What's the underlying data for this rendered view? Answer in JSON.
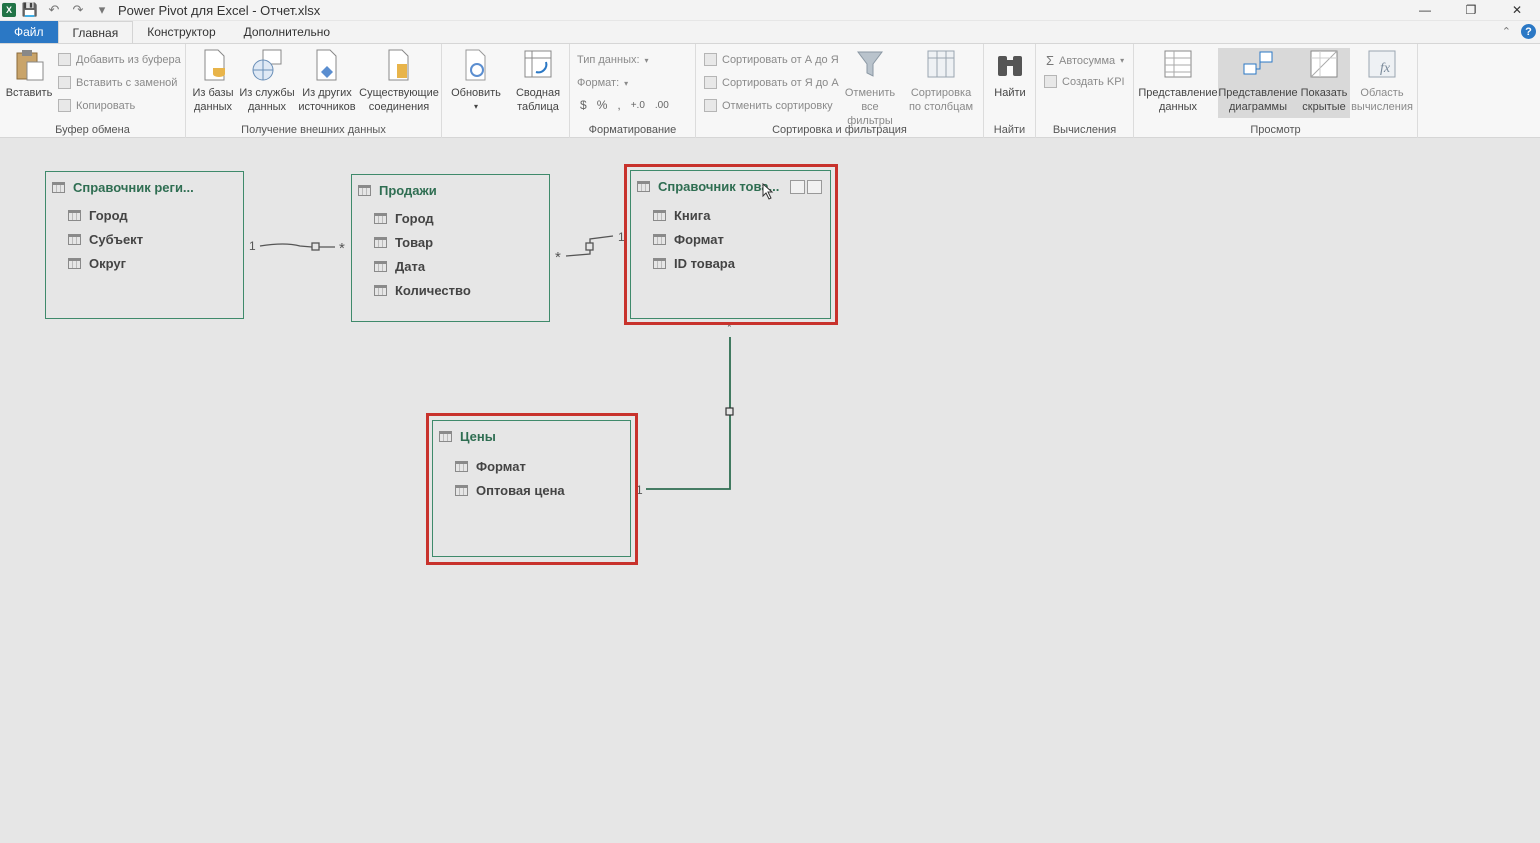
{
  "window": {
    "title": "Power Pivot для Excel - Отчет.xlsx"
  },
  "tabs": [
    {
      "label": "Файл"
    },
    {
      "label": "Главная"
    },
    {
      "label": "Конструктор"
    },
    {
      "label": "Дополнительно"
    }
  ],
  "ribbon": {
    "clipboard": {
      "label": "Буфер обмена",
      "paste": "Вставить",
      "add_from_clipboard": "Добавить из буфера",
      "paste_replace": "Вставить с заменой",
      "copy": "Копировать"
    },
    "external": {
      "label": "Получение внешних данных",
      "from_db_1": "Из базы",
      "from_db_2": "данных",
      "from_service_1": "Из службы",
      "from_service_2": "данных",
      "from_other_1": "Из других",
      "from_other_2": "источников",
      "existing_1": "Существующие",
      "existing_2": "соединения"
    },
    "refresh": "Обновить",
    "pivot_1": "Сводная",
    "pivot_2": "таблица",
    "formatting": {
      "label": "Форматирование",
      "data_type": "Тип данных:",
      "format": "Формат:",
      "currency": "$",
      "percent": "%",
      "thousands": ",",
      "inc_dec": "+.0",
      "dec_dec": ".00"
    },
    "sort": {
      "label": "Сортировка и фильтрация",
      "sort_az": "Сортировать от А до Я",
      "sort_za": "Сортировать от Я до А",
      "clear_sort": "Отменить сортировку",
      "clear_filters_1": "Отменить",
      "clear_filters_2": "все фильтры",
      "sort_by_col_1": "Сортировка",
      "sort_by_col_2": "по столбцам"
    },
    "find": {
      "label": "Найти",
      "find": "Найти"
    },
    "calc": {
      "label": "Вычисления",
      "autosum": "Автосумма",
      "create_kpi": "Создать KPI"
    },
    "view": {
      "label": "Просмотр",
      "data_view_1": "Представление",
      "data_view_2": "данных",
      "diagram_view_1": "Представление",
      "diagram_view_2": "диаграммы",
      "show_hidden_1": "Показать",
      "show_hidden_2": "скрытые",
      "calc_area_1": "Область",
      "calc_area_2": "вычисления"
    }
  },
  "diagram": {
    "tables": [
      {
        "title": "Справочник реги...",
        "columns": [
          "Город",
          "Субъект",
          "Округ"
        ]
      },
      {
        "title": "Продажи",
        "columns": [
          "Город",
          "Товар",
          "Дата",
          "Количество"
        ]
      },
      {
        "title": "Справочник това...",
        "columns": [
          "Книга",
          "Формат",
          "ID товара"
        ]
      },
      {
        "title": "Цены",
        "columns": [
          "Формат",
          "Оптовая цена"
        ]
      }
    ],
    "relations": {
      "r1_one": "1",
      "r1_many": "*",
      "r2_many": "*",
      "r2_one": "1",
      "r3_many": "*",
      "r3_one": "1"
    }
  },
  "colors": {
    "file_tab": "#2b78c5",
    "table_border": "#3f8a6b",
    "selection": "#c8322c"
  }
}
